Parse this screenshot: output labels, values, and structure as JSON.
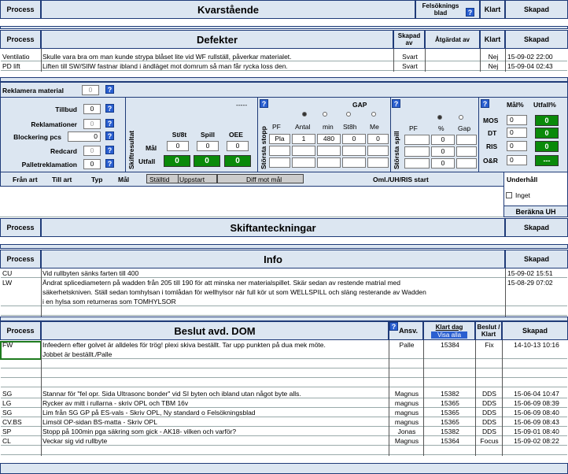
{
  "kvar": {
    "process": "Process",
    "title": "Kvarstående",
    "fels": "Felsöknings blad",
    "klart": "Klart",
    "skapad": "Skapad"
  },
  "defekter": {
    "process": "Process",
    "title": "Defekter",
    "skapad_av": "Skapad av",
    "atgardat": "Åtgärdat av",
    "klart": "Klart",
    "skapad": "Skapad",
    "rows": [
      {
        "process": "Ventilatio",
        "text": "Skulle vara bra om man kunde strypa blåset lite vid WF rullställ, påverkar materialet.",
        "av": "Svart",
        "klart": "Nej",
        "skapad": "15-09-02 22:00"
      },
      {
        "process": "PD lift",
        "text": "Liften till SW/SIlW fastnar ibland i ändläget mot domrum så man får rycka loss den.",
        "av": "Svart",
        "klart": "Nej",
        "skapad": "15-09-04 02:43"
      }
    ]
  },
  "reklamera": {
    "label": "Reklamera material",
    "value": "0"
  },
  "skiftres": {
    "vlabel": "Skiftresultat",
    "rows": [
      {
        "l": "Tillbud",
        "v": "0"
      },
      {
        "l": "Reklamationer",
        "v": "0"
      },
      {
        "l": "Blockering pcs",
        "v": "0"
      },
      {
        "l": "Redcard",
        "v": "0"
      },
      {
        "l": "Palletreklamation",
        "v": "0"
      }
    ],
    "dash": "-----",
    "h1": "St/8t",
    "h2": "Spill",
    "h3": "OEE",
    "mal": "Mål",
    "utfall": "Utfall",
    "mal_vals": [
      "0",
      "0",
      "0"
    ],
    "utfall_vals": [
      "0",
      "0",
      "0"
    ]
  },
  "stopp": {
    "vlabel": "Största stopp",
    "gap": "GAP",
    "h": [
      "PF",
      "Antal",
      "min",
      "St8h",
      "Me"
    ],
    "row1": [
      "Pla",
      "1",
      "480",
      "0",
      "0"
    ]
  },
  "spill": {
    "vlabel": "Största spill",
    "h": [
      "PF",
      "%",
      "Gap"
    ],
    "vals": [
      "0",
      "0",
      "0"
    ]
  },
  "mos": {
    "mal": "Mål%",
    "utfall": "Utfall%",
    "rows": [
      {
        "l": "MOS",
        "m": "0",
        "u": "0"
      },
      {
        "l": "DT",
        "m": "0",
        "u": "0"
      },
      {
        "l": "RIS",
        "m": "0",
        "u": "0"
      },
      {
        "l": "O&R",
        "m": "0",
        "u": "---"
      }
    ]
  },
  "diffrow": {
    "fran": "Från art",
    "till": "Till art",
    "typ": "Typ",
    "mal": "Mål",
    "stalltid": "Ställtid",
    "uppstart": "Uppstart",
    "diff": "Diff mot mål",
    "oml": "Oml./UH/RIS start"
  },
  "underhall": {
    "title": "Underhåll",
    "inget": "Inget",
    "berakna": "Beräkna UH"
  },
  "skiftant": {
    "process": "Process",
    "title": "Skiftanteckningar",
    "skapad": "Skapad"
  },
  "info": {
    "process": "Process",
    "title": "Info",
    "skapad": "Skapad",
    "rows": [
      {
        "process": "CU",
        "text": "Vid rullbyten sänks farten till 400",
        "skapad": "15-09-02 15:51"
      },
      {
        "process": "LW",
        "text": "Ändrat splicediametern på wadden från 205 till 190 för att minska ner materialspillet. Skär sedan av restende matrial med",
        "skapad": "15-08-29 07:02"
      },
      {
        "process": "",
        "text": "säkerhetskniven. Ställ sedan tomhylsan i tomlådan för wellhylsor när full kör ut som WELLSPILL och släng resterande av Wadden",
        "skapad": ""
      },
      {
        "process": "",
        "text": "i en hylsa som returneras som TOMHYLSOR",
        "skapad": ""
      }
    ]
  },
  "beslut": {
    "process": "Process",
    "title": "Beslut  avd. DOM",
    "ansv": "Ansv.",
    "klartdag": "Klart dag",
    "visa": "Visa alla",
    "beslut": "Beslut / Klart",
    "skapad": "Skapad",
    "rows": [
      {
        "process": "FW",
        "text": "Infeedern efter golvet är alldeles för trög! plexi skiva beställt. Tar upp punkten på dua mek möte.",
        "ansv": "Palle",
        "dag": "15384",
        "bes": "Fix",
        "skapad": "14-10-13 10:16"
      },
      {
        "process": "",
        "text": "Jobbet är beställt./Palle",
        "ansv": "",
        "dag": "",
        "bes": "",
        "skapad": ""
      },
      {
        "process": "SG",
        "text": "Stannar för \"fel opr. Sida Ultrasonc bonder\" vid SI byten och ibland utan något byte alls.",
        "ansv": "Magnus",
        "dag": "15382",
        "bes": "DDS",
        "skapad": "15-06-04 10:47"
      },
      {
        "process": "LG",
        "text": "Rycker av mitt i rullarna - skriv OPL och TBM 16v",
        "ansv": "magnus",
        "dag": "15365",
        "bes": "DDS",
        "skapad": "15-06-09 08:39"
      },
      {
        "process": "SG",
        "text": "Lim från SG GP på ES-vals - Skriv OPL, Ny standard o Felsökningsblad",
        "ansv": "magnus",
        "dag": "15365",
        "bes": "DDS",
        "skapad": "15-06-09 08:40"
      },
      {
        "process": "CV.BS",
        "text": "Limsöl OP-sidan BS-matta - Skriv OPL",
        "ansv": "magnus",
        "dag": "15365",
        "bes": "DDS",
        "skapad": "15-06-09 08:43"
      },
      {
        "process": "SP",
        "text": "Stopp på 100min pga säkring som gick - AK18- vilken och varför?",
        "ansv": "Jonas",
        "dag": "15382",
        "bes": "DDS",
        "skapad": "15-09-01 08:40"
      },
      {
        "process": "CL",
        "text": "Veckar sig vid rullbyte",
        "ansv": "Magnus",
        "dag": "15364",
        "bes": "Focus",
        "skapad": "15-09-02 08:22"
      }
    ]
  }
}
